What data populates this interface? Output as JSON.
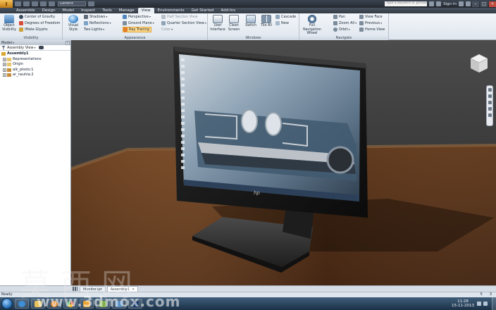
{
  "colors": {
    "ribbon_bg": "#e9eef4",
    "active_tab": "#e9eef4",
    "highlight": "#fdd98b",
    "viewport_top": "#4c4c4c",
    "viewport_bottom": "#2d2d2d",
    "taskbar": "#2a4a68"
  },
  "titlebar": {
    "app_icon": "I",
    "qa_field": "Generic",
    "search_placeholder": "Type a keyword or phrase",
    "sign_in": "Sign In",
    "icons": [
      "save-icon",
      "undo-icon",
      "redo-icon",
      "help-icon",
      "minimize-icon",
      "maximize-icon",
      "close-icon"
    ]
  },
  "tabs": [
    "Assemble",
    "Design",
    "Model",
    "Inspect",
    "Tools",
    "Manage",
    "View",
    "Environments",
    "Get Started",
    "Add-Ins"
  ],
  "active_tab": "View",
  "ribbon": {
    "visibility": {
      "title": "Visibility",
      "object_visibility": "Object Visibility",
      "center_of_gravity": "Center of Gravity",
      "degrees_of_freedom": "Degrees of Freedom",
      "ilogic_glyphs": "iMate Glyphs"
    },
    "appearance": {
      "title": "Appearance",
      "visual_style": "Visual Style",
      "shadows": "Shadows",
      "reflections": "Reflections",
      "two_lights": "Two Lights",
      "perspective": "Perspective",
      "ground_plane": "Ground Plane",
      "ray_tracing": "Ray Tracing",
      "half_section": "Half Section View",
      "quarter_section": "Quarter Section View",
      "color": "Color"
    },
    "windows": {
      "title": "Windows",
      "user_interface": "User Interface",
      "clean_screen": "Clean Screen",
      "switch": "Switch",
      "tile_all": "Tile All",
      "cascade": "Cascade",
      "new": "New"
    },
    "navigate": {
      "title": "Navigate",
      "full_navigation_wheel": "Full Navigation Wheel",
      "pan": "Pan",
      "zoom_all": "Zoom All",
      "orbit": "Orbit",
      "view_face": "View Face",
      "previous": "Previous",
      "home_view": "Home View"
    }
  },
  "browser": {
    "header": "Model",
    "view_select": "Assembly View",
    "tree": {
      "root": "Assembly1",
      "children": [
        "Representations",
        "Origin",
        "alk_plsolo:1",
        "ar_nauhla:2"
      ]
    }
  },
  "document_tabs": [
    {
      "label": "Monitor.ipt"
    },
    {
      "label": "Assembly1"
    }
  ],
  "statusbar": {
    "text": "Ready",
    "num_a": "5",
    "num_b": "3"
  },
  "taskbar": {
    "time": "11:28",
    "date": "15-11-2013",
    "apps": [
      "ie-icon",
      "explorer-icon",
      "media-icon",
      "chrome-icon",
      "inventor-icon",
      "files-icon",
      "mail-icon",
      "ps-icon"
    ]
  },
  "watermark": {
    "chinese": "莫西网",
    "url": "www.3dmox.com"
  },
  "monitor": {
    "brand": "hp"
  }
}
